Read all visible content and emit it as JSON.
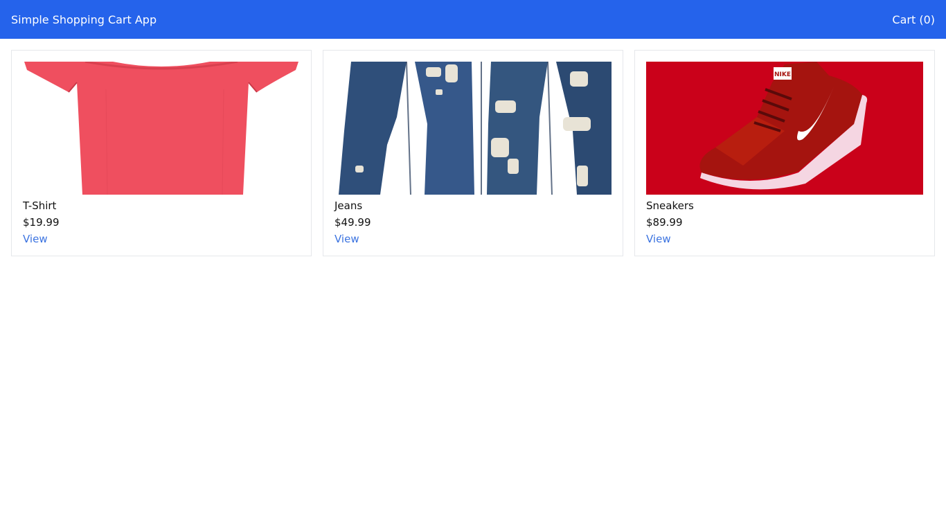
{
  "header": {
    "title": "Simple Shopping Cart App",
    "cart_label": "Cart (0)"
  },
  "products": [
    {
      "name": "T-Shirt",
      "price": "$19.99",
      "link_label": "View",
      "image_icon": "tshirt-image"
    },
    {
      "name": "Jeans",
      "price": "$49.99",
      "link_label": "View",
      "image_icon": "jeans-image"
    },
    {
      "name": "Sneakers",
      "price": "$89.99",
      "link_label": "View",
      "image_icon": "sneaker-image",
      "logo_text": "NIKE"
    }
  ],
  "colors": {
    "navbar": "#2563eb",
    "link": "#3b73e0",
    "card_border": "#e5e7eb"
  }
}
